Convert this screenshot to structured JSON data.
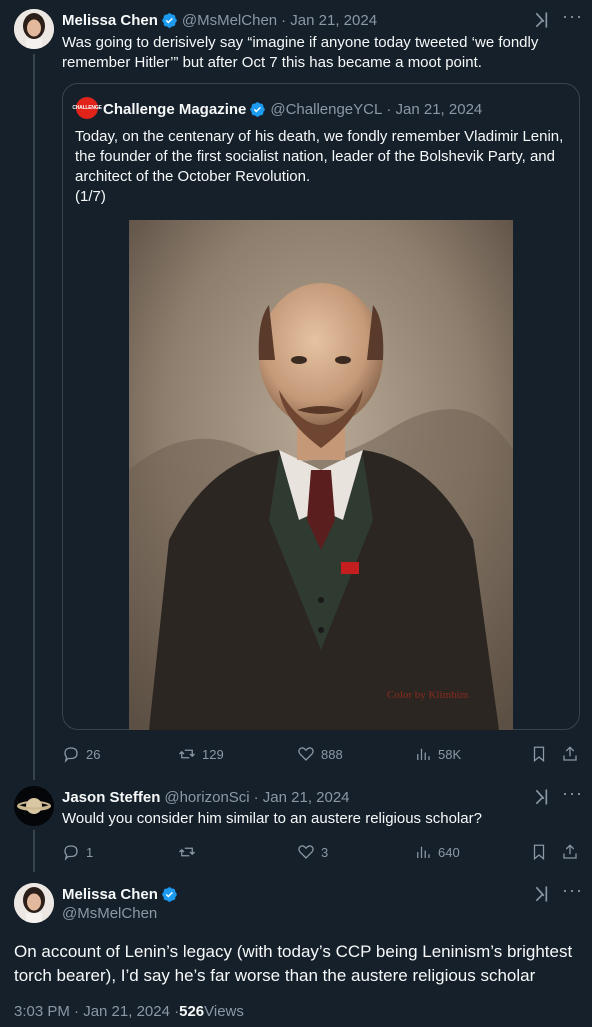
{
  "tweet1": {
    "name": "Melissa Chen",
    "handle": "@MsMelChen",
    "date": "· Jan 21, 2024",
    "text": "Was going to derisively say “imagine if anyone today tweeted ‘we fondly remember Hitler’” but after Oct 7 this has became a moot point.",
    "quote": {
      "logo_text": "CHALLENGE",
      "name": "Challenge Magazine",
      "handle": "@ChallengeYCL",
      "date": "· Jan 21, 2024",
      "text_lines": [
        "Today, on the centenary of his death, we fondly remember Vladimir Lenin,",
        "the founder of the first socialist nation, leader of the Bolshevik Party, and",
        "architect of the October Revolution.",
        "(1/7)"
      ],
      "image_caption": "Color by Klimbim"
    },
    "actions": {
      "replies": "26",
      "retweets": "129",
      "likes": "888",
      "views": "58K"
    }
  },
  "tweet2": {
    "name": "Jason Steffen",
    "handle": "@horizonSci",
    "date": "· Jan 21, 2024",
    "text": "Would you consider him similar to an austere religious scholar?",
    "actions": {
      "replies": "1",
      "retweets": "",
      "likes": "3",
      "views": "640"
    }
  },
  "main": {
    "name": "Melissa Chen",
    "handle": "@MsMelChen",
    "text_lines": [
      "On account of Lenin’s legacy (with today’s CCP being Leninism’s brightest",
      "torch bearer), I’d say he’s far worse than the austere religious scholar"
    ],
    "time": "3:03 PM · Jan 21, 2024 · ",
    "views_count": "526",
    "views_label": " Views"
  },
  "colors": {
    "background": "#15202b",
    "verified": "#1d9bf0",
    "muted": "#8b98a5",
    "border": "#38444d"
  }
}
